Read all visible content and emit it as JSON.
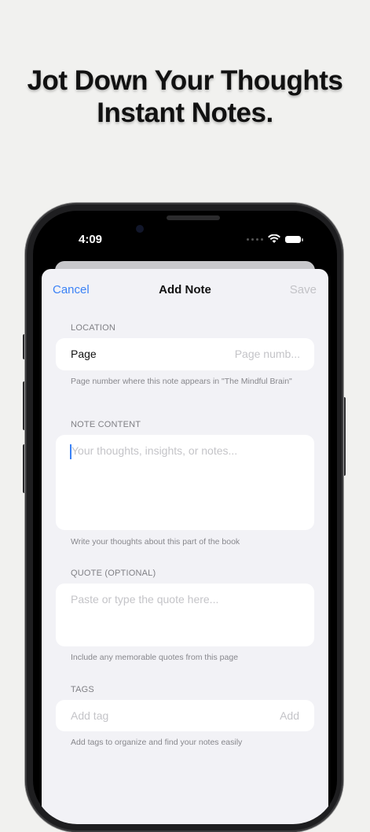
{
  "headline": {
    "line1": "Jot Down Your Thoughts",
    "line2": "Instant Notes."
  },
  "status_bar": {
    "time": "4:09",
    "signal_icon": "cellular-dots-icon",
    "wifi_icon": "wifi-icon",
    "battery_icon": "battery-icon"
  },
  "nav": {
    "cancel": "Cancel",
    "title": "Add Note",
    "save": "Save"
  },
  "location": {
    "section_label": "LOCATION",
    "field_label": "Page",
    "placeholder": "Page numb...",
    "footer": "Page number where this note appears in \"The Mindful Brain\""
  },
  "note_content": {
    "section_label": "NOTE CONTENT",
    "placeholder": "Your thoughts, insights, or notes...",
    "footer": "Write your thoughts about this part of the book"
  },
  "quote": {
    "section_label": "QUOTE (OPTIONAL)",
    "placeholder": "Paste or type the quote here...",
    "footer": "Include any memorable quotes from this page"
  },
  "tags": {
    "section_label": "TAGS",
    "placeholder": "Add tag",
    "add_button": "Add",
    "footer": "Add tags to organize and find your notes easily"
  },
  "colors": {
    "accent": "#3b82f6",
    "background": "#f1f1ef",
    "sheet": "#f2f2f6"
  }
}
